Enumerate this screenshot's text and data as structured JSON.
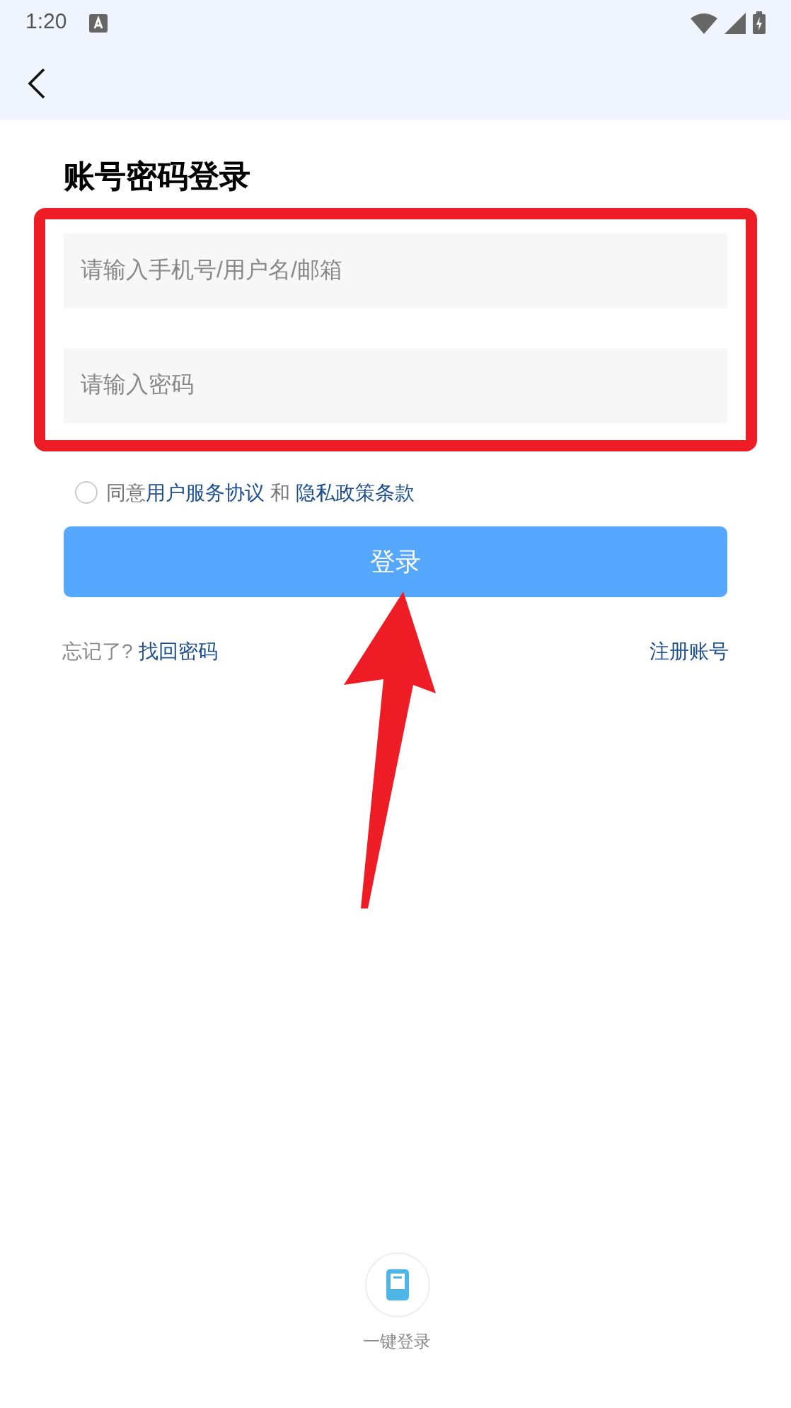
{
  "status_bar": {
    "time": "1:20"
  },
  "title": "账号密码登录",
  "fields": [
    {
      "placeholder": "请输入手机号/用户名/邮箱"
    },
    {
      "placeholder": "请输入密码"
    }
  ],
  "agreement": {
    "checked": false,
    "prefix": "同意",
    "terms_link": "用户服务协议",
    "joiner": "和",
    "privacy_link": "隐私政策条款"
  },
  "login_button": "登录",
  "forgot": {
    "prefix": "忘记了?",
    "link": "找回密码"
  },
  "register_link": "注册账号",
  "one_tap": {
    "label": "一键登录"
  }
}
